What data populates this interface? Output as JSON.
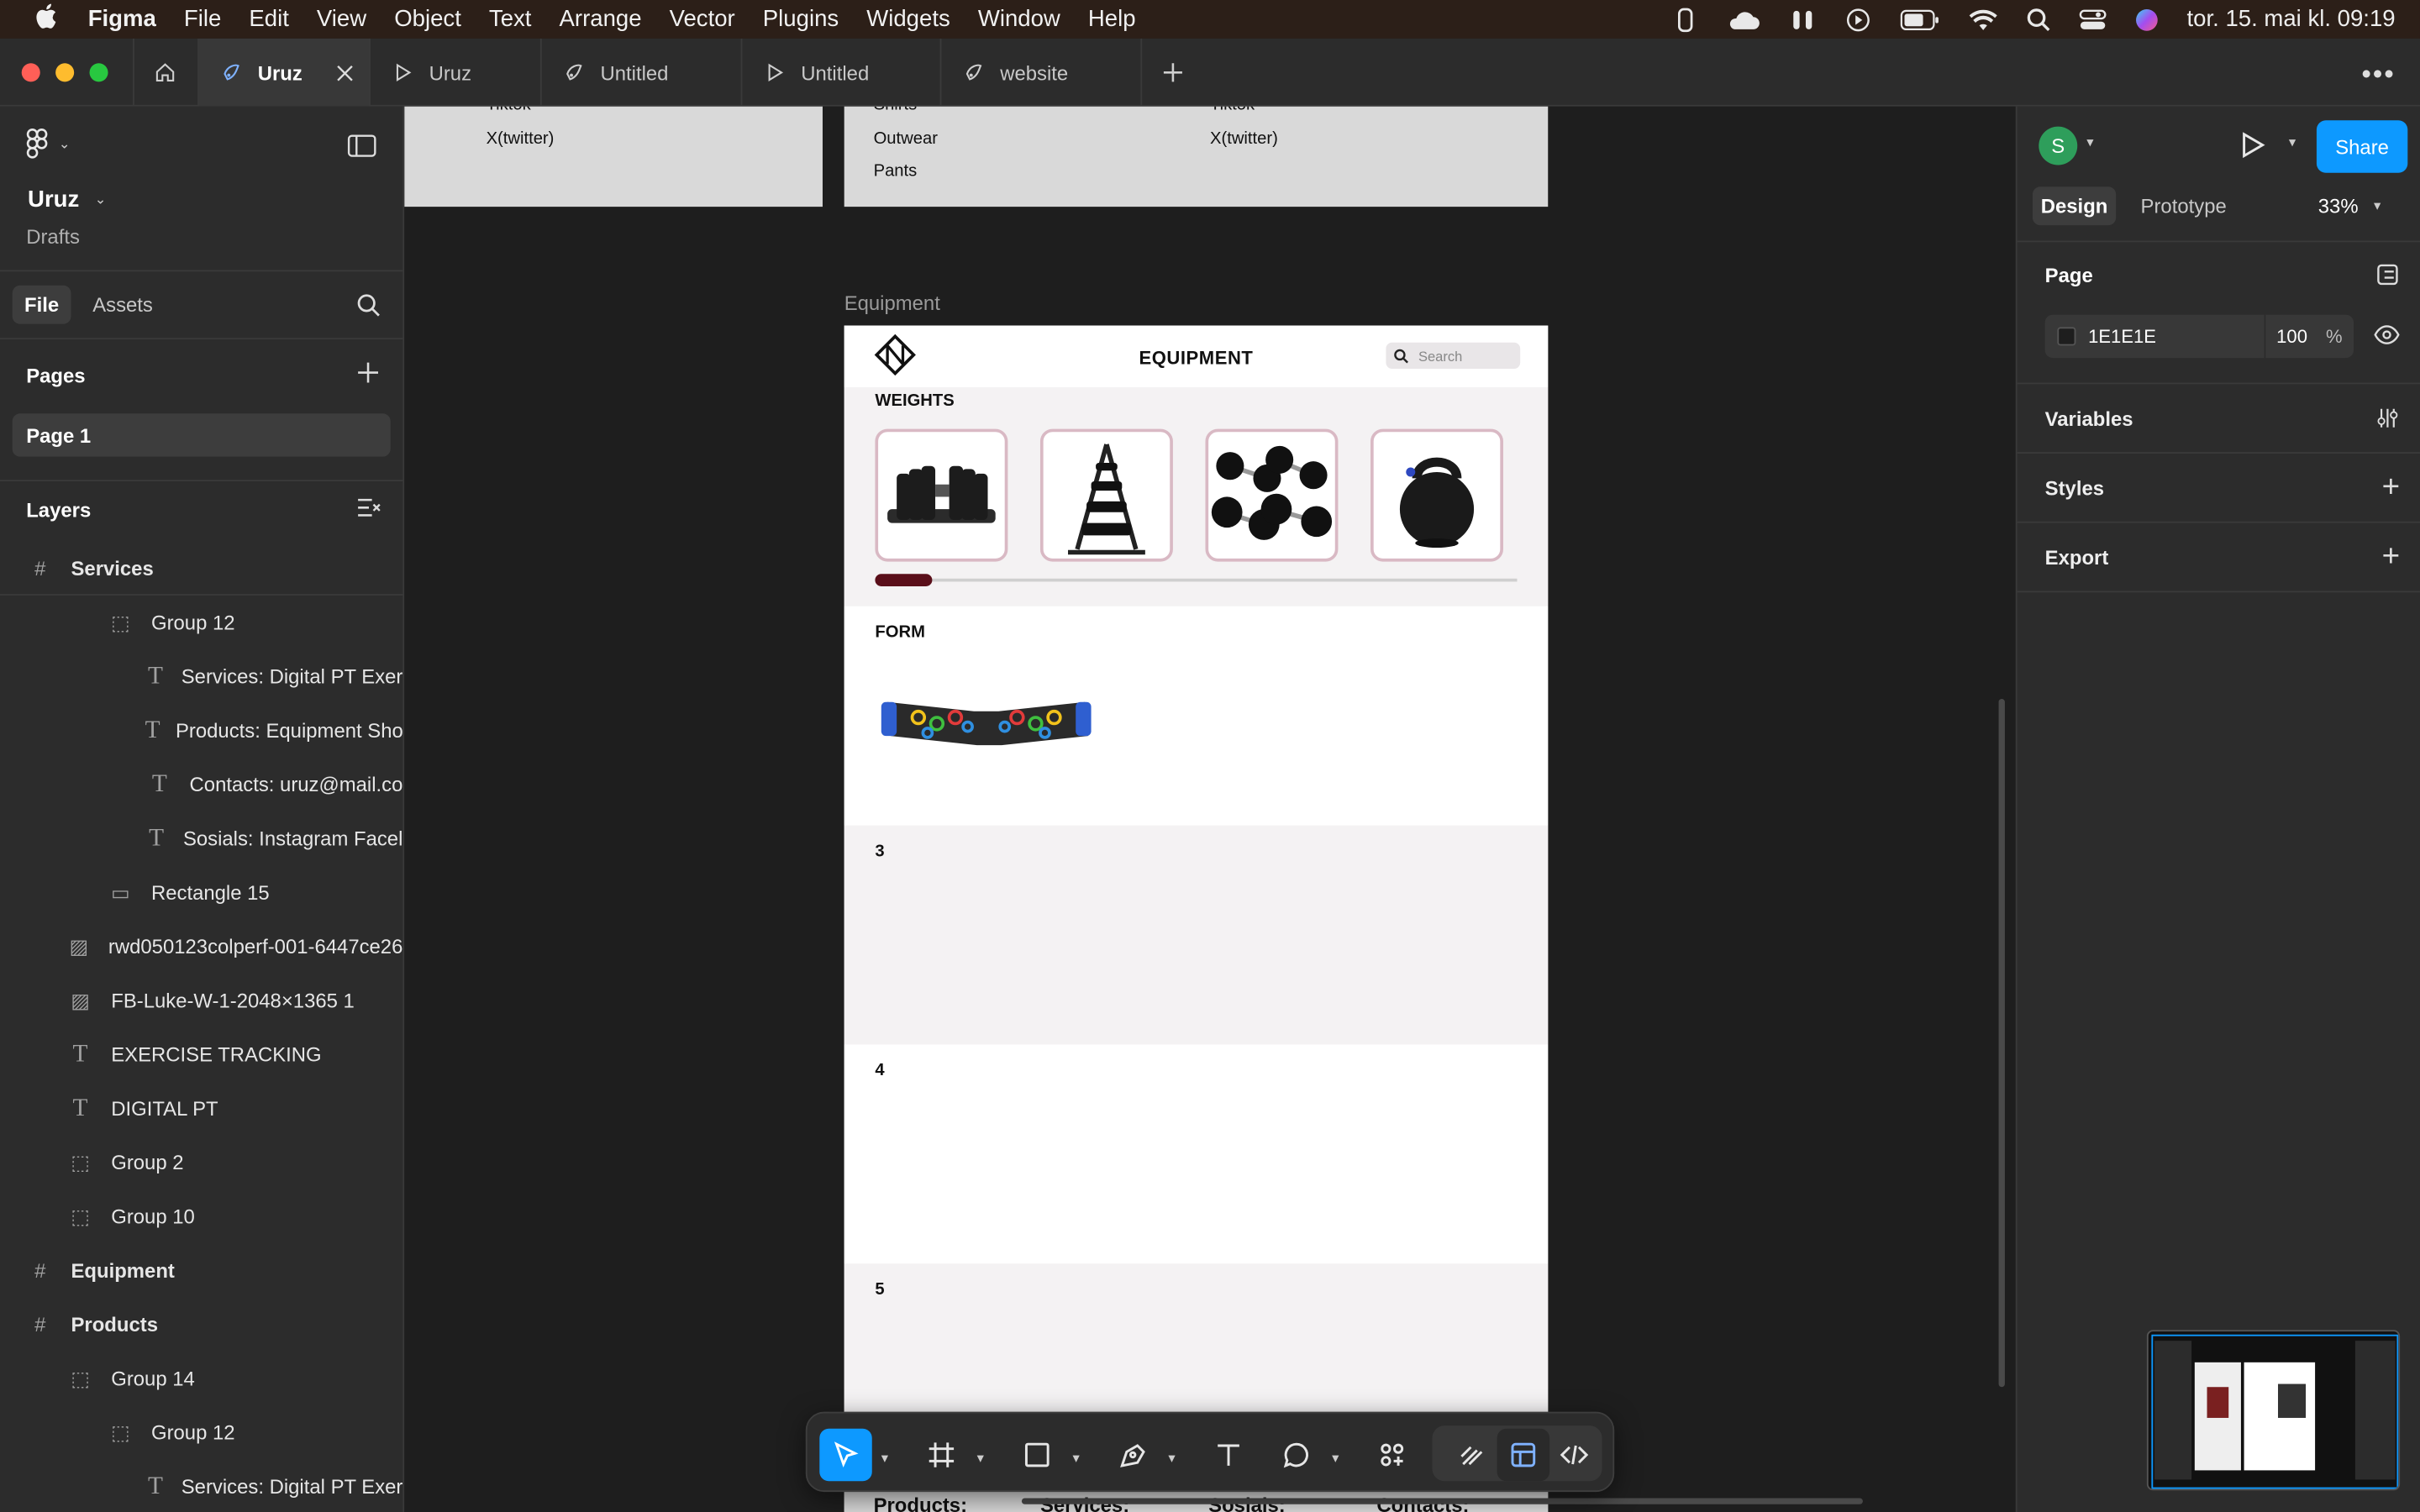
{
  "menubar": {
    "items": [
      "Figma",
      "File",
      "Edit",
      "View",
      "Object",
      "Text",
      "Arrange",
      "Vector",
      "Plugins",
      "Widgets",
      "Window",
      "Help"
    ],
    "clock": "tor. 15. mai kl. 09:19"
  },
  "tabs": [
    {
      "label": "Uruz",
      "icon": "figma-file-icon",
      "active": true
    },
    {
      "label": "Uruz",
      "icon": "play-icon"
    },
    {
      "label": "Untitled",
      "icon": "figma-file-icon"
    },
    {
      "label": "Untitled",
      "icon": "play-icon"
    },
    {
      "label": "website",
      "icon": "figma-file-icon"
    }
  ],
  "left_panel": {
    "file_name": "Uruz",
    "location": "Drafts",
    "tab_file": "File",
    "tab_assets": "Assets",
    "pages_title": "Pages",
    "pages": [
      "Page 1"
    ],
    "layers_title": "Layers",
    "layers": [
      {
        "label": "Services",
        "type": "frame"
      },
      {
        "label": "Group 12",
        "type": "group"
      },
      {
        "label": "Services: Digital PT Exer",
        "type": "text"
      },
      {
        "label": "Products: Equipment Sho",
        "type": "text"
      },
      {
        "label": "Contacts: uruz@mail.co",
        "type": "text"
      },
      {
        "label": "Sosials: Instagram Facel",
        "type": "text"
      },
      {
        "label": "Rectangle 15",
        "type": "rectangle"
      },
      {
        "label": "rwd050123colperf-001-6447ce26",
        "type": "image"
      },
      {
        "label": "FB-Luke-W-1-2048×1365 1",
        "type": "image"
      },
      {
        "label": "EXERCISE TRACKING",
        "type": "text"
      },
      {
        "label": "DIGITAL PT",
        "type": "text"
      },
      {
        "label": "Group 2",
        "type": "group"
      },
      {
        "label": "Group 10",
        "type": "group"
      },
      {
        "label": "Equipment",
        "type": "frame"
      },
      {
        "label": "Products",
        "type": "frame"
      },
      {
        "label": "Group 14",
        "type": "group"
      },
      {
        "label": "Group 12",
        "type": "group"
      },
      {
        "label": "Services: Digital PT Exer",
        "type": "text"
      }
    ]
  },
  "canvas": {
    "top_frame_a": {
      "items": [
        "Tiktok",
        "X(twitter)"
      ]
    },
    "top_frame_b": {
      "col1": [
        "Shirts",
        "Outwear",
        "Pants"
      ],
      "col2": [
        "Tiktok",
        "X(twitter)"
      ]
    },
    "frame_label": "Equipment",
    "equipment": {
      "title": "EQUIPMENT",
      "search_placeholder": "Search",
      "section_weights": "WEIGHTS",
      "section_form": "FORM",
      "section_3": "3",
      "section_4": "4",
      "section_5": "5",
      "slider_fraction": 0.09,
      "footer": [
        "Products:",
        "Services:",
        "Sosials:",
        "Contacts:"
      ]
    }
  },
  "right_panel": {
    "avatar_initial": "S",
    "share_label": "Share",
    "tab_design": "Design",
    "tab_prototype": "Prototype",
    "zoom": "33%",
    "page_title": "Page",
    "bg_color": "1E1E1E",
    "bg_opacity": "100",
    "percent_sign": "%",
    "variables": "Variables",
    "styles": "Styles",
    "export": "Export"
  },
  "colors": {
    "accent": "#0d99ff",
    "canvas_bg": "#1E1E1E",
    "slider_thumb": "#5a0f1a",
    "avatar": "#2e9e5b"
  }
}
